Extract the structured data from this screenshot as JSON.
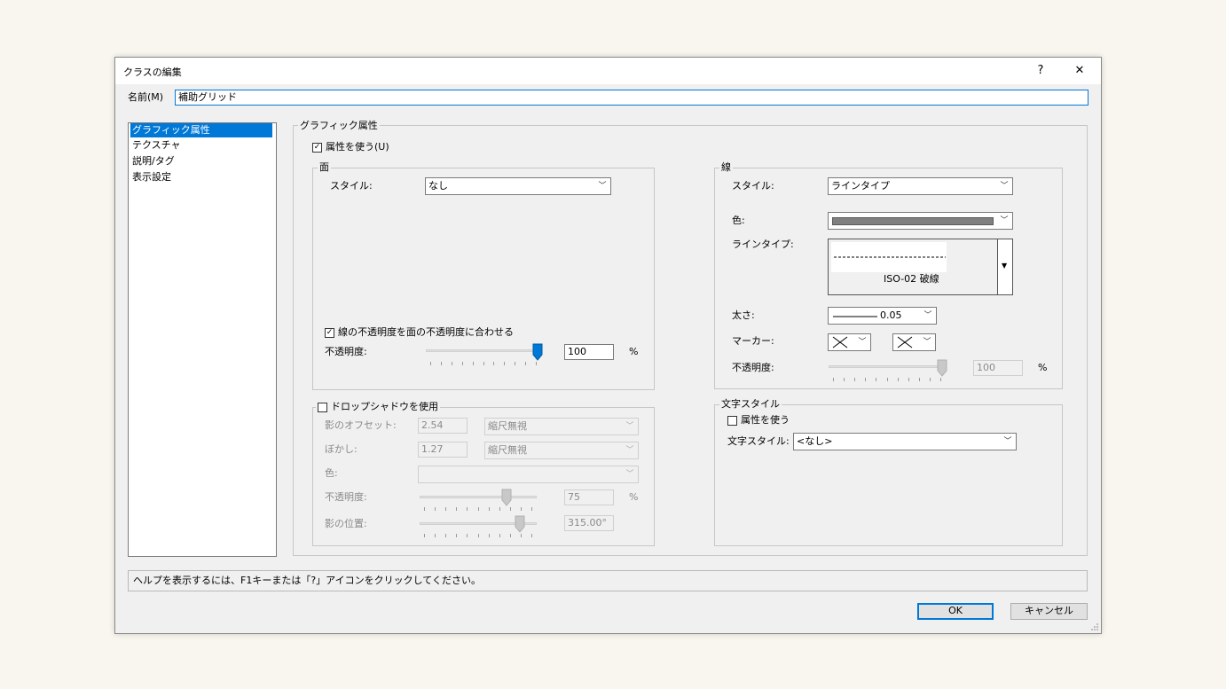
{
  "dialog": {
    "title": "クラスの編集",
    "help_glyph": "?",
    "close_glyph": "✕"
  },
  "name_field": {
    "label": "名前(M)",
    "value": "補助グリッド"
  },
  "categories": [
    "グラフィック属性",
    "テクスチャ",
    "説明/タグ",
    "表示設定"
  ],
  "graphic": {
    "group_title": "グラフィック属性",
    "use_attributes": "属性を使う(U)",
    "fill": {
      "title": "面",
      "style_label": "スタイル:",
      "style_value": "なし",
      "match_opacity": "線の不透明度を面の不透明度に合わせる",
      "opacity_label": "不透明度:",
      "opacity_value": "100",
      "opacity_unit": "%",
      "opacity_fraction": 1.0
    },
    "shadow": {
      "title": "ドロップシャドウを使用",
      "offset_label": "影のオフセット:",
      "offset_value": "2.54",
      "offset_mode": "縮尺無視",
      "blur_label": "ぼかし:",
      "blur_value": "1.27",
      "blur_mode": "縮尺無視",
      "color_label": "色:",
      "opacity_label": "不透明度:",
      "opacity_value": "75",
      "opacity_unit": "%",
      "opacity_fraction": 0.75,
      "angle_label": "影の位置:",
      "angle_value": "315.00°",
      "angle_fraction": 0.875
    },
    "line": {
      "title": "線",
      "style_label": "スタイル:",
      "style_value": "ラインタイプ",
      "color_label": "色:",
      "color_hex": "#808080",
      "linetype_label": "ラインタイプ:",
      "linetype_name": "ISO-02 破線",
      "weight_label": "太さ:",
      "weight_value": "0.05",
      "marker_label": "マーカー:",
      "opacity_label": "不透明度:",
      "opacity_value": "100",
      "opacity_unit": "%",
      "opacity_fraction": 1.0
    },
    "text_style": {
      "title": "文字スタイル",
      "use_attributes": "属性を使う",
      "label": "文字スタイル:",
      "value": "<なし>"
    }
  },
  "status_text": "ヘルプを表示するには、F1キーまたは「?」アイコンをクリックしてください。",
  "buttons": {
    "ok": "OK",
    "cancel": "キャンセル"
  },
  "colors": {
    "accent": "#0078d7",
    "selection_text": "#ffffff"
  }
}
